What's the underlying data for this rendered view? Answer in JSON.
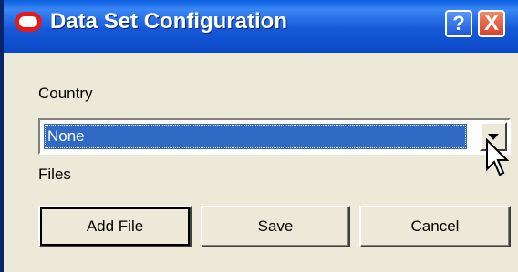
{
  "window": {
    "title": "Data Set Configuration",
    "logo_icon": "oracle-logo-icon",
    "help_label": "?",
    "close_label": "X"
  },
  "form": {
    "country_label": "Country",
    "country_selected": "None",
    "files_label": "Files"
  },
  "buttons": {
    "add_file": "Add File",
    "save": "Save",
    "cancel": "Cancel"
  },
  "colors": {
    "titlebar": "#1659d8",
    "selection": "#316ac5",
    "dialog_bg": "#ece9d8",
    "logo_red": "#e51b1b",
    "close_red": "#d8402a"
  }
}
